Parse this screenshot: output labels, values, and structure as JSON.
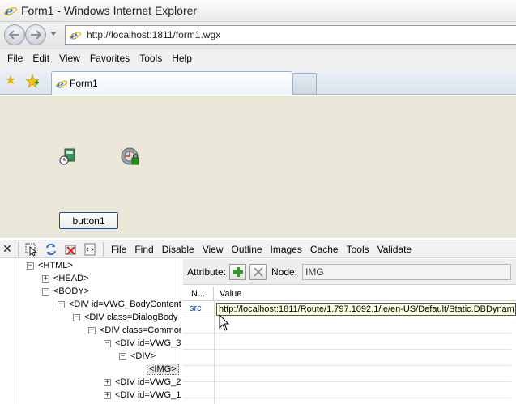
{
  "window": {
    "title": "Form1 - Windows Internet Explorer"
  },
  "address": {
    "url": "http://localhost:1811/form1.wgx"
  },
  "menu": [
    "File",
    "Edit",
    "View",
    "Favorites",
    "Tools",
    "Help"
  ],
  "tab": {
    "label": "Form1"
  },
  "form": {
    "button_label": "button1"
  },
  "devtools": {
    "menu": [
      "File",
      "Find",
      "Disable",
      "View",
      "Outline",
      "Images",
      "Cache",
      "Tools",
      "Validate"
    ],
    "tree": [
      {
        "toggle": "−",
        "label": "<HTML>"
      },
      {
        "toggle": "+",
        "label": "<HEAD>"
      },
      {
        "toggle": "−",
        "label": "<BODY>"
      },
      {
        "toggle": "−",
        "label": "<DIV id=VWG_BodyContent"
      },
      {
        "toggle": "−",
        "label": "<DIV class=DialogBody"
      },
      {
        "toggle": "−",
        "label": "<DIV class=Commor"
      },
      {
        "toggle": "−",
        "label": "<DIV id=VWG_3"
      },
      {
        "toggle": "−",
        "label": "<DIV>"
      },
      {
        "toggle": "",
        "label": "<IMG>"
      },
      {
        "toggle": "+",
        "label": "<DIV id=VWG_2"
      },
      {
        "toggle": "+",
        "label": "<DIV id=VWG_1"
      }
    ],
    "attributes": {
      "attribute_label": "Attribute:",
      "node_label": "Node:",
      "node_value": "IMG",
      "col_name": "N...",
      "col_value": "Value",
      "rows": [
        {
          "name": "src",
          "value": "http://localhost:1811/Route/1.797.1092.1/ie/en-US/Default/Static.DBDynam"
        }
      ]
    }
  }
}
